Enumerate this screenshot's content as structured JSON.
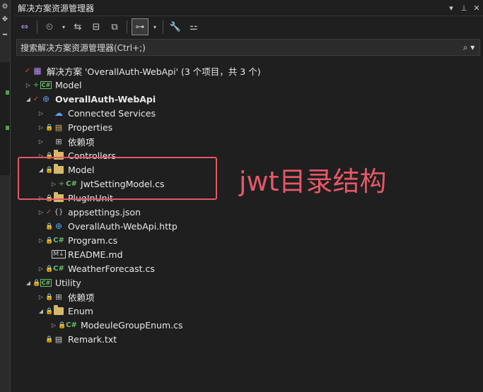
{
  "panel": {
    "title": "解决方案资源管理器",
    "controls": [
      "▾",
      "📌",
      "✕"
    ]
  },
  "search": {
    "placeholder": "搜索解决方案资源管理器(Ctrl+;)"
  },
  "tree": [
    {
      "label": "解决方案 'OverallAuth-WebApi' (3 个项目，共 3 个)",
      "indent": 0,
      "arrow": "",
      "badge": "check",
      "icon": "solution",
      "bold": false
    },
    {
      "label": "Model",
      "indent": 1,
      "arrow": "▷",
      "badge": "plus",
      "icon": "csproj",
      "bold": false
    },
    {
      "label": "OverallAuth-WebApi",
      "indent": 1,
      "arrow": "◢",
      "badge": "check",
      "icon": "web",
      "bold": true
    },
    {
      "label": "Connected Services",
      "indent": 2,
      "arrow": "▷",
      "badge": "",
      "icon": "cloud",
      "bold": false
    },
    {
      "label": "Properties",
      "indent": 2,
      "arrow": "▷",
      "badge": "lock",
      "icon": "props",
      "bold": false
    },
    {
      "label": "依赖项",
      "indent": 2,
      "arrow": "▷",
      "badge": "",
      "icon": "deps",
      "bold": false
    },
    {
      "label": "Controllers",
      "indent": 2,
      "arrow": "▷",
      "badge": "lock",
      "icon": "folder",
      "bold": false
    },
    {
      "label": "Model",
      "indent": 2,
      "arrow": "◢",
      "badge": "lock",
      "icon": "folder",
      "bold": false
    },
    {
      "label": "JwtSettingModel.cs",
      "indent": 3,
      "arrow": "▷",
      "badge": "plus",
      "icon": "cs",
      "bold": false
    },
    {
      "label": "PlugInUnit",
      "indent": 2,
      "arrow": "▷",
      "badge": "lock",
      "icon": "folder",
      "bold": false
    },
    {
      "label": "appsettings.json",
      "indent": 2,
      "arrow": "▷",
      "badge": "check",
      "icon": "json",
      "bold": false
    },
    {
      "label": "OverallAuth-WebApi.http",
      "indent": 2,
      "arrow": "",
      "badge": "lock",
      "icon": "http",
      "bold": false
    },
    {
      "label": "Program.cs",
      "indent": 2,
      "arrow": "▷",
      "badge": "lock",
      "icon": "cs",
      "bold": false
    },
    {
      "label": "README.md",
      "indent": 2,
      "arrow": "",
      "badge": "",
      "icon": "md",
      "bold": false
    },
    {
      "label": "WeatherForecast.cs",
      "indent": 2,
      "arrow": "▷",
      "badge": "lock",
      "icon": "cs",
      "bold": false
    },
    {
      "label": "Utility",
      "indent": 1,
      "arrow": "◢",
      "badge": "lock",
      "icon": "csproj",
      "bold": false
    },
    {
      "label": "依赖项",
      "indent": 2,
      "arrow": "▷",
      "badge": "lock",
      "icon": "deps",
      "bold": false
    },
    {
      "label": "Enum",
      "indent": 2,
      "arrow": "◢",
      "badge": "lock",
      "icon": "folder",
      "bold": false
    },
    {
      "label": "ModeuleGroupEnum.cs",
      "indent": 3,
      "arrow": "▷",
      "badge": "lock",
      "icon": "cs",
      "bold": false
    },
    {
      "label": "Remark.txt",
      "indent": 2,
      "arrow": "",
      "badge": "lock",
      "icon": "txt",
      "bold": false
    }
  ],
  "annotation": {
    "text": "jwt目录结构",
    "color": "#e35868"
  },
  "colors": {
    "background": "#1f1f1f",
    "accent_green": "#68c26b",
    "folder": "#d8b86a",
    "lock": "#5aa0e8"
  }
}
